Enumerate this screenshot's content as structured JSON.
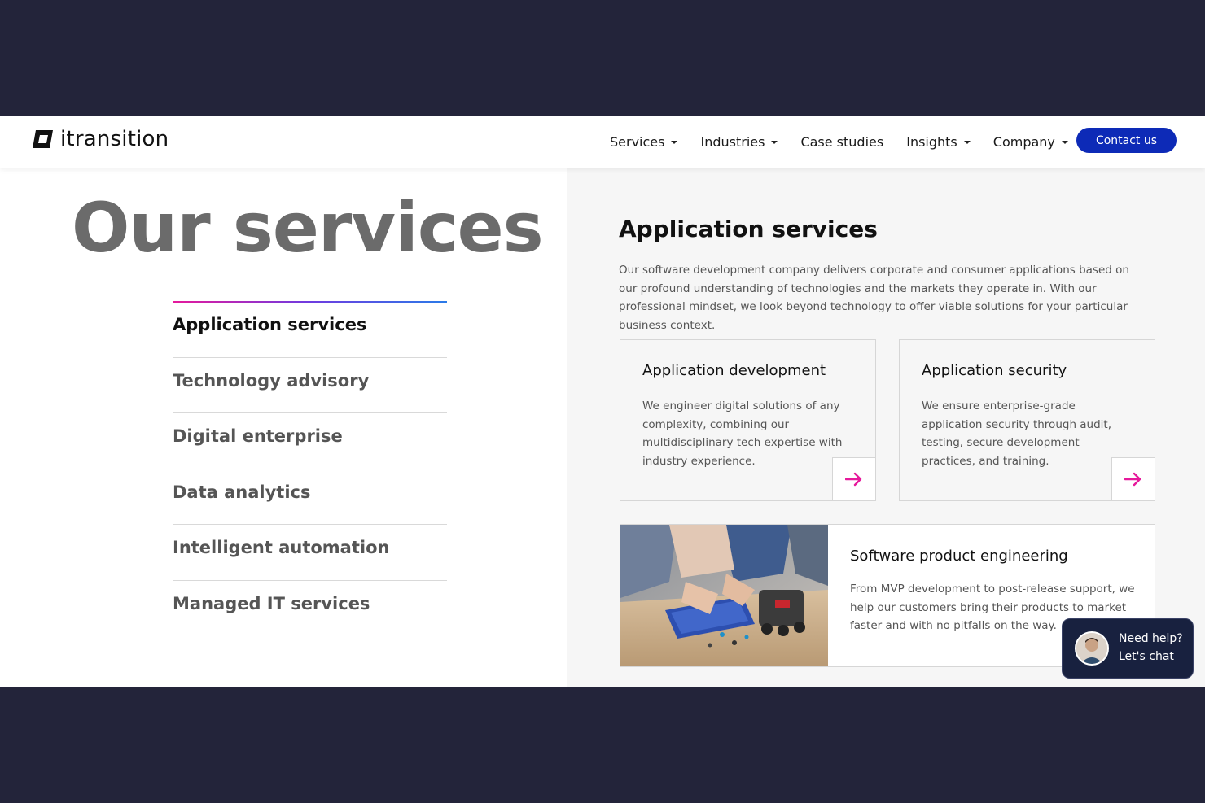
{
  "brand": {
    "name": "itransition"
  },
  "nav": {
    "items": [
      {
        "label": "Services",
        "dropdown": true
      },
      {
        "label": "Industries",
        "dropdown": true
      },
      {
        "label": "Case studies",
        "dropdown": false
      },
      {
        "label": "Insights",
        "dropdown": true
      },
      {
        "label": "Company",
        "dropdown": true
      }
    ],
    "contact_label": "Contact us"
  },
  "page_title": "Our services",
  "services": [
    {
      "label": "Application services",
      "active": true
    },
    {
      "label": "Technology advisory",
      "active": false
    },
    {
      "label": "Digital enterprise",
      "active": false
    },
    {
      "label": "Data analytics",
      "active": false
    },
    {
      "label": "Intelligent automation",
      "active": false
    },
    {
      "label": "Managed IT services",
      "active": false
    }
  ],
  "detail": {
    "title": "Application services",
    "description": "Our software development company delivers corporate and consumer applications based on our profound understanding of technologies and the markets they operate in. With our professional mindset, we look beyond technology to offer viable solutions for your particular business context.",
    "cards": [
      {
        "title": "Application development",
        "text": "We engineer digital solutions of any complexity, combining our multidisciplinary tech expertise with industry experience."
      },
      {
        "title": "Application security",
        "text": "We ensure enterprise-grade application security through audit, testing, secure development practices, and training."
      }
    ],
    "feature": {
      "title": "Software product engineering",
      "text": "From MVP development to post-release support, we help our customers bring their products to market faster and with no pitfalls on the way."
    }
  },
  "chat": {
    "line1": "Need help?",
    "line2": "Let's chat"
  },
  "colors": {
    "accent": "#0d2ab7",
    "arrow": "#e6199b",
    "background": "#23243a"
  }
}
